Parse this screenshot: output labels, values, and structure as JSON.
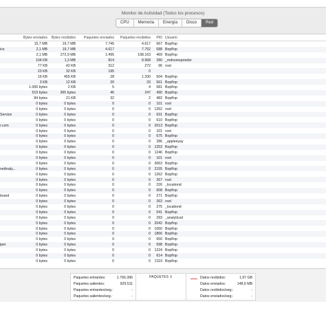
{
  "window": {
    "title": "Monitor de Actividad (Todos los procesos)",
    "tabs": [
      {
        "label": "CPU"
      },
      {
        "label": "Memoria"
      },
      {
        "label": "Energía"
      },
      {
        "label": "Disco"
      },
      {
        "label": "Red"
      }
    ]
  },
  "table": {
    "headers": {
      "name": "",
      "sent": "Bytes enviados",
      "recv": "Bytes recibidos",
      "psent": "Paquetes enviados",
      "precv": "Paquetes recibidos",
      "pid": "PID",
      "user": "Usuario"
    },
    "rows": [
      {
        "name": "",
        "sent": "15,7 MB",
        "recv": "19,7 MB",
        "psent": "7.745",
        "precv": "4.617",
        "pid": "667",
        "user": "Bopf/op"
      },
      {
        "name": "ice",
        "sent": "2,1 MB",
        "recv": "19,7 MB",
        "psent": "4.617",
        "precv": "7.752",
        "pid": "688",
        "user": "Bopf/op"
      },
      {
        "name": "",
        "sent": "2,1 MB",
        "recv": "272,9 MB",
        "psent": "1.495",
        "precv": "198.163",
        "pid": "469",
        "user": "Bopf/op"
      },
      {
        "name": "",
        "sent": "104 KB",
        "recv": "1,3 MB",
        "psent": "814",
        "precv": "8.968",
        "pid": "280",
        "user": "_mdnsresponder"
      },
      {
        "name": "",
        "sent": "77 KB",
        "recv": "42 KB",
        "psent": "312",
        "precv": "272",
        "pid": "96",
        "user": "root"
      },
      {
        "name": "",
        "sent": "23 KB",
        "recv": "32 KB",
        "psent": "195",
        "precv": "0",
        "pid": "",
        "user": ""
      },
      {
        "name": "",
        "sent": "19 KB",
        "recv": "455 KB",
        "psent": "28",
        "precv": "1.330",
        "pid": "504",
        "user": "Bopf/op"
      },
      {
        "name": "",
        "sent": "3 KB",
        "recv": "12 KB",
        "psent": "20",
        "precv": "33",
        "pid": "561",
        "user": "Bopf/op"
      },
      {
        "name": "",
        "sent": "1.006 bytes",
        "recv": "2 KB",
        "psent": "5",
        "precv": "4",
        "pid": "581",
        "user": "Bopf/op"
      },
      {
        "name": "",
        "sent": "519 bytes",
        "recv": "365 bytes",
        "psent": "46",
        "precv": "247",
        "pid": "490",
        "user": "Bopf/op"
      },
      {
        "name": "",
        "sent": "84 bytes",
        "recv": "21 KB",
        "psent": "32",
        "precv": "2",
        "pid": "482",
        "user": "Bopf/op"
      },
      {
        "name": "",
        "sent": "0 bytes",
        "recv": "0 bytes",
        "psent": "0",
        "precv": "0",
        "pid": "101",
        "user": "root"
      },
      {
        "name": "",
        "sent": "0 bytes",
        "recv": "0 bytes",
        "psent": "0",
        "precv": "0",
        "pid": "1262",
        "user": "root"
      },
      {
        "name": "Service",
        "sent": "0 bytes",
        "recv": "0 bytes",
        "psent": "0",
        "precv": "0",
        "pid": "631",
        "user": "Bopf/op"
      },
      {
        "name": "",
        "sent": "0 bytes",
        "recv": "0 bytes",
        "psent": "0",
        "precv": "0",
        "pid": "610",
        "user": "Bopf/op"
      },
      {
        "name": "r.com",
        "sent": "0 bytes",
        "recv": "0 bytes",
        "psent": "0",
        "precv": "0",
        "pid": "2013",
        "user": "Bopf/op"
      },
      {
        "name": "",
        "sent": "0 bytes",
        "recv": "0 bytes",
        "psent": "0",
        "precv": "0",
        "pid": "101",
        "user": "root"
      },
      {
        "name": "",
        "sent": "0 bytes",
        "recv": "0 bytes",
        "psent": "0",
        "precv": "0",
        "pid": "675",
        "user": "Bopf/op"
      },
      {
        "name": "",
        "sent": "0 bytes",
        "recv": "0 bytes",
        "psent": "0",
        "precv": "0",
        "pid": "286",
        "user": "_appleeyay"
      },
      {
        "name": "",
        "sent": "0 bytes",
        "recv": "0 bytes",
        "psent": "0",
        "precv": "0",
        "pid": "1253",
        "user": "Bopf/op"
      },
      {
        "name": "",
        "sent": "0 bytes",
        "recv": "0 bytes",
        "psent": "0",
        "precv": "0",
        "pid": "1246",
        "user": "Bopf/op"
      },
      {
        "name": "",
        "sent": "0 bytes",
        "recv": "0 bytes",
        "psent": "0",
        "precv": "0",
        "pid": "101",
        "user": "root"
      },
      {
        "name": "",
        "sent": "0 bytes",
        "recv": "0 bytes",
        "psent": "0",
        "precv": "0",
        "pid": "3063",
        "user": "Bopf/op"
      },
      {
        "name": "neAnaly...",
        "sent": "0 bytes",
        "recv": "0 bytes",
        "psent": "0",
        "precv": "0",
        "pid": "2155",
        "user": "Bopf/op"
      },
      {
        "name": "",
        "sent": "0 bytes",
        "recv": "0 bytes",
        "psent": "0",
        "precv": "0",
        "pid": "1262",
        "user": "Bopf/op"
      },
      {
        "name": "",
        "sent": "0 bytes",
        "recv": "0 bytes",
        "psent": "0",
        "precv": "0",
        "pid": "267",
        "user": "root"
      },
      {
        "name": "",
        "sent": "0 bytes",
        "recv": "0 bytes",
        "psent": "0",
        "precv": "0",
        "pid": "226",
        "user": "_locationd"
      },
      {
        "name": "",
        "sent": "0 bytes",
        "recv": "0 bytes",
        "psent": "0",
        "precv": "0",
        "pid": "608",
        "user": "Bopf/op"
      },
      {
        "name": "board",
        "sent": "0 bytes",
        "recv": "0 bytes",
        "psent": "0",
        "precv": "0",
        "pid": "271",
        "user": "Bopf/op"
      },
      {
        "name": "",
        "sent": "0 bytes",
        "recv": "0 bytes",
        "psent": "0",
        "precv": "0",
        "pid": "263",
        "user": "root"
      },
      {
        "name": "",
        "sent": "0 bytes",
        "recv": "0 bytes",
        "psent": "0",
        "precv": "0",
        "pid": "275",
        "user": "_locationd"
      },
      {
        "name": "",
        "sent": "0 bytes",
        "recv": "0 bytes",
        "psent": "0",
        "precv": "0",
        "pid": "541",
        "user": "Bopf/op"
      },
      {
        "name": "",
        "sent": "0 bytes",
        "recv": "0 bytes",
        "psent": "0",
        "precv": "0",
        "pid": "293",
        "user": "_analyticsd"
      },
      {
        "name": "",
        "sent": "0 bytes",
        "recv": "0 bytes",
        "psent": "0",
        "precv": "0",
        "pid": "2042",
        "user": "Bopf/op"
      },
      {
        "name": "",
        "sent": "0 bytes",
        "recv": "0 bytes",
        "psent": "0",
        "precv": "0",
        "pid": "1060",
        "user": "Bopf/op"
      },
      {
        "name": "",
        "sent": "0 bytes",
        "recv": "0 bytes",
        "psent": "0",
        "precv": "0",
        "pid": "1866",
        "user": "Bopf/op"
      },
      {
        "name": "",
        "sent": "0 bytes",
        "recv": "0 bytes",
        "psent": "0",
        "precv": "0",
        "pid": "650",
        "user": "Bopf/op"
      },
      {
        "name": "iper",
        "sent": "0 bytes",
        "recv": "0 bytes",
        "psent": "0",
        "precv": "0",
        "pid": "598",
        "user": "Bopf/op"
      },
      {
        "name": "",
        "sent": "0 bytes",
        "recv": "0 bytes",
        "psent": "0",
        "precv": "0",
        "pid": "1224",
        "user": "Bopf/op"
      },
      {
        "name": "",
        "sent": "0 bytes",
        "recv": "0 bytes",
        "psent": "0",
        "precv": "0",
        "pid": "614",
        "user": "Bopf/op"
      },
      {
        "name": "",
        "sent": "0 bytes",
        "recv": "0 bytes",
        "psent": "0",
        "precv": "0",
        "pid": "2119",
        "user": "Bopf/op"
      }
    ]
  },
  "footer": {
    "left": [
      {
        "label": "Paquetes entrantes:",
        "value": "1.766.396"
      },
      {
        "label": "Paquetes salientes:",
        "value": "929.511"
      },
      {
        "label": "Paquetes entrantes/seg.:",
        "value": "-"
      },
      {
        "label": "Paquetes salientes/seg.:",
        "value": "-"
      }
    ],
    "graph_selector": "PAQUETES",
    "right": [
      {
        "label": "Datos recibidos:",
        "value": "1,97 GB"
      },
      {
        "label": "Datos enviados:",
        "value": "148,6 MB"
      },
      {
        "label": "Datos recibidos/seg.:",
        "value": "-"
      },
      {
        "label": "Datos enviados/seg.:",
        "value": "-"
      }
    ]
  },
  "colors": {
    "active_tab": "#6b6b6b",
    "graph_received": "#d9534f",
    "graph_sent": "#4a78c2"
  }
}
